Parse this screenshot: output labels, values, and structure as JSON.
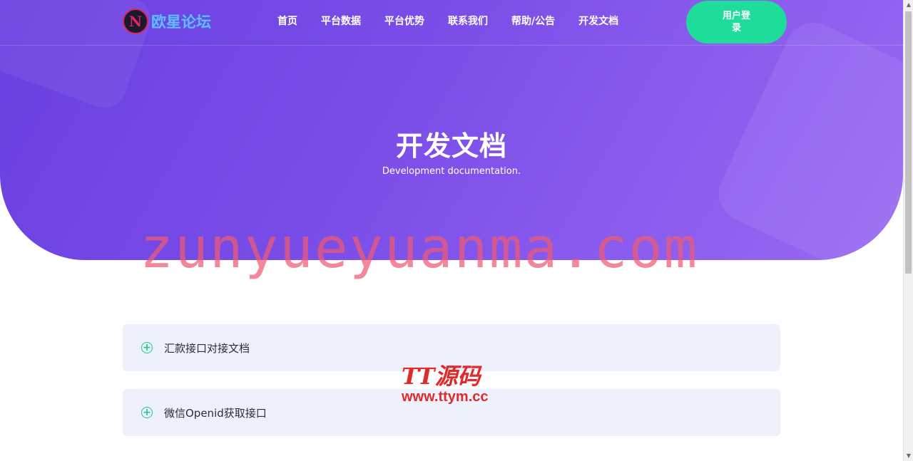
{
  "brand": {
    "logo_letter": "N",
    "name": "欧星论坛"
  },
  "nav": {
    "items": [
      {
        "label": "首页"
      },
      {
        "label": "平台数据"
      },
      {
        "label": "平台优势"
      },
      {
        "label": "联系我们"
      },
      {
        "label": "帮助/公告"
      },
      {
        "label": "开发文档"
      }
    ],
    "login_label": "用户登录"
  },
  "hero": {
    "title": "开发文档",
    "subtitle": "Development documentation."
  },
  "docs": [
    {
      "icon": "plus-circle-icon",
      "label": "汇款接口对接文档"
    },
    {
      "icon": "plus-circle-icon",
      "label": "微信Openid获取接口"
    }
  ],
  "watermarks": {
    "main": "zunyueyuanma.com",
    "tt_top": "TT源码",
    "tt_bottom": "www.ttym.cc"
  },
  "colors": {
    "hero_start": "#6a3fe0",
    "hero_end": "#9a6af3",
    "accent_green": "#1fdc9a",
    "card_bg": "#eef0fb"
  }
}
